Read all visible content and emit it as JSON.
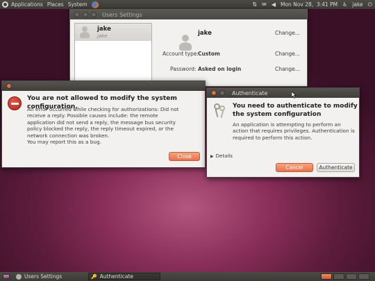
{
  "top_panel": {
    "menus": [
      "Applications",
      "Places",
      "System"
    ],
    "datetime": "Mon Nov 28,  3:41 PM",
    "user": "jake"
  },
  "users_window": {
    "title": "Users Settings",
    "list_user_name": "jake",
    "list_user_login": "jake",
    "detail_name": "jake",
    "change_label": "Change...",
    "account_type_label": "Account type:",
    "account_type_value": "Custom",
    "password_label": "Password:",
    "password_value": "Asked on login"
  },
  "error_dialog": {
    "heading": "You are not allowed to modify the system configuration.",
    "message": "An error occurred while checking for authorizations: Did not receive a reply. Possible causes include: the remote application did not send a reply, the message bus security policy blocked the reply, the reply timeout expired, or the network connection was broken.\nYou may report this as a bug.",
    "close_label": "Close"
  },
  "auth_dialog": {
    "title": "Authenticate",
    "heading": "You need to authenticate to modify the system configuration",
    "message": "An application is attempting to perform an action that requires privileges. Authentication is required to perform this action.",
    "details_label": "Details",
    "cancel_label": "Cancel",
    "authenticate_label": "Authenticate"
  },
  "taskbar": {
    "items": [
      "Users Settings",
      "Authenticate"
    ]
  },
  "colors": {
    "accent": "#e8734a",
    "panel": "#3c3b37"
  }
}
